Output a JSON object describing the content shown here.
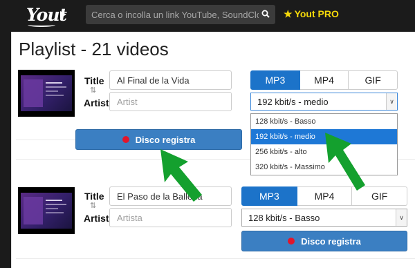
{
  "header": {
    "logo_text": "Yout",
    "search_placeholder": "Cerca o incolla un link YouTube, SoundCloud",
    "pro_label": "Yout PRO"
  },
  "page": {
    "title": "Playlist - 21 videos"
  },
  "videos": [
    {
      "title_label": "Title",
      "title_value": "Al Final de la Vida",
      "artist_label": "Artist",
      "artist_placeholder": "Artist",
      "swap_icon": "⇅",
      "formats": [
        "MP3",
        "MP4",
        "GIF"
      ],
      "active_format": "MP3",
      "quality_selected": "192 kbit/s - medio",
      "quality_options": [
        "128 kbit/s - Basso",
        "192 kbit/s - medio",
        "256 kbit/s - alto",
        "320 kbit/s - Massimo"
      ],
      "record_label": "Disco registra"
    },
    {
      "title_label": "Title",
      "title_value": "El Paso de la Ballena",
      "artist_label": "Artist",
      "artist_placeholder": "Artista",
      "swap_icon": "⇅",
      "formats": [
        "MP3",
        "MP4",
        "GIF"
      ],
      "active_format": "MP3",
      "quality_selected": "128 kbit/s - Basso",
      "record_label": "Disco registra"
    }
  ],
  "colors": {
    "accent": "#1c73c9",
    "record_dot": "#e2162c",
    "pro": "#f5d90a",
    "arrow": "#14a02e"
  }
}
